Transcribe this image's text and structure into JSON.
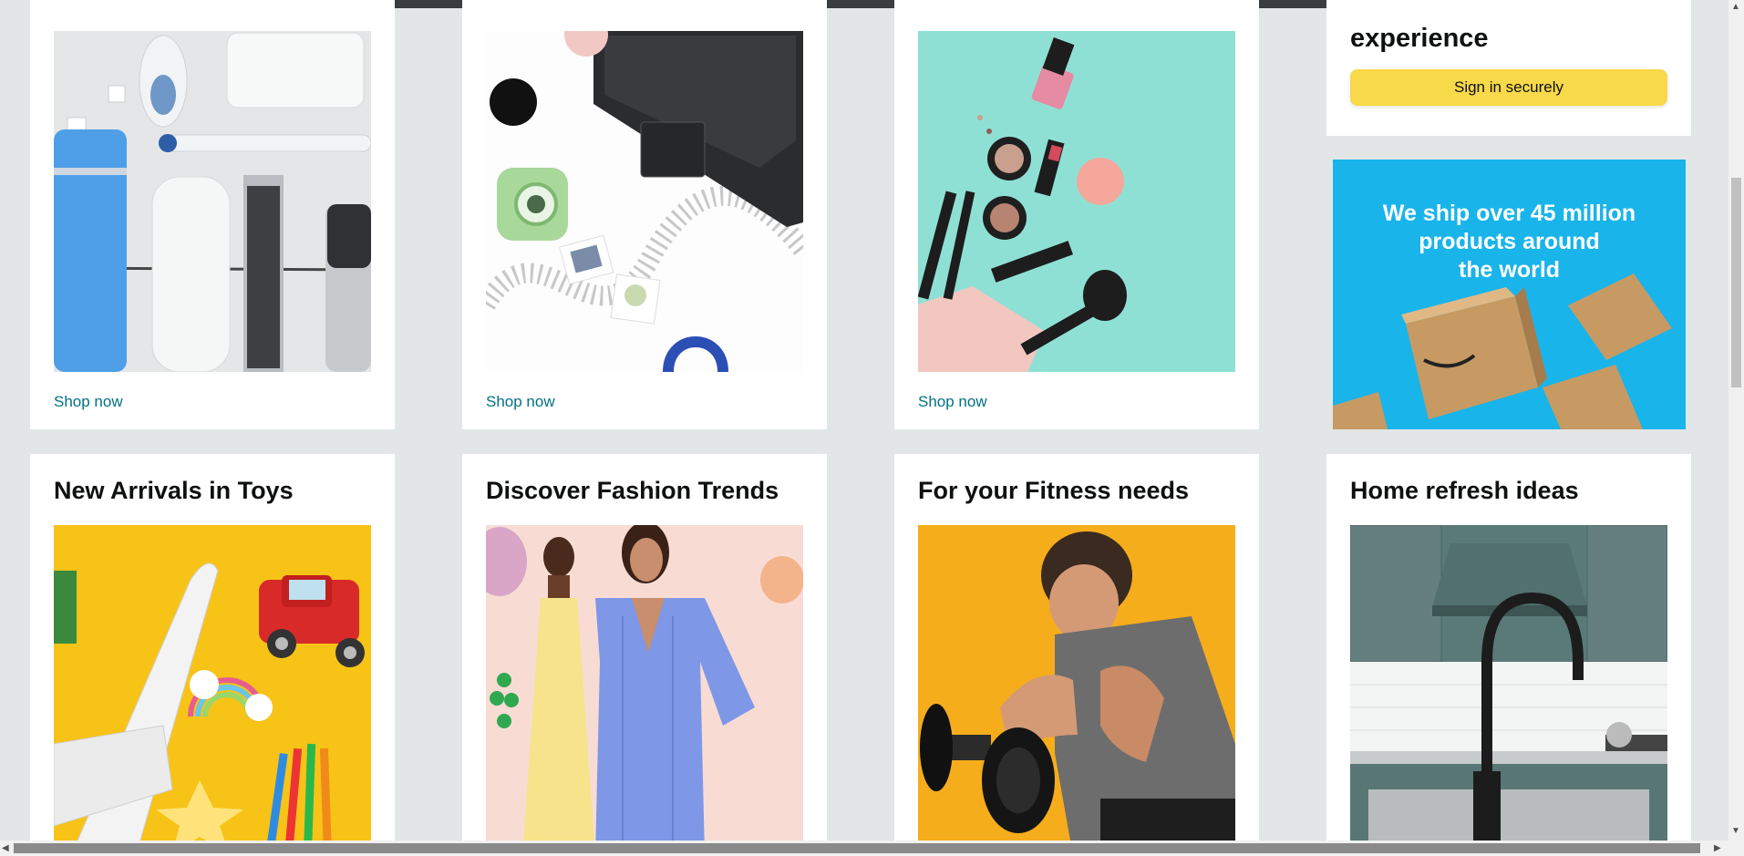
{
  "row1": [
    {
      "link": "Shop now"
    },
    {
      "link": "Shop now"
    },
    {
      "link": "Shop now"
    }
  ],
  "signin": {
    "heading": "experience",
    "button": "Sign in securely"
  },
  "promo": {
    "line1": "We ship over 45 million",
    "line2": "products around",
    "line3": "the world"
  },
  "row2": [
    {
      "title": "New Arrivals in Toys"
    },
    {
      "title": "Discover Fashion Trends"
    },
    {
      "title": "For your Fitness needs"
    },
    {
      "title": "Home refresh ideas"
    }
  ],
  "colors": {
    "background": "#e3e6e6",
    "link": "#007185",
    "button": "#f7d94a",
    "promo": "#19b4ea"
  }
}
